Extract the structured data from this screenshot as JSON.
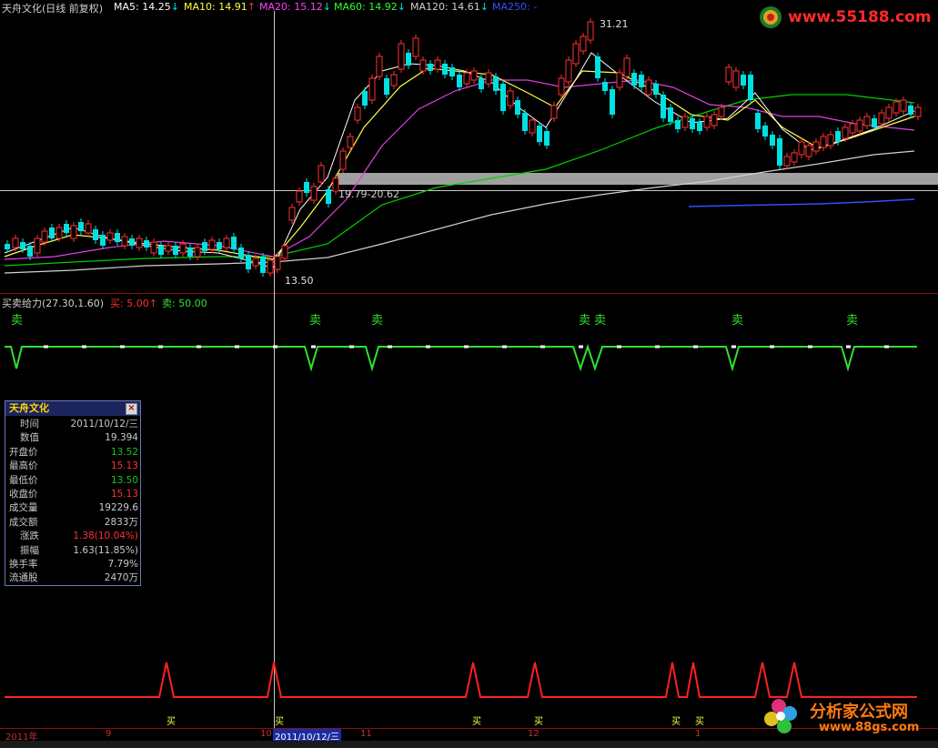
{
  "top_legend": {
    "title": "天舟文化(日线 前复权)",
    "ma5": "MA5: 14.25",
    "ma10": "MA10: 14.91",
    "ma20": "MA20: 15.12",
    "ma60": "MA60: 14.92",
    "ma120": "MA120: 14.61",
    "ma250": "MA250: -"
  },
  "price_annotations": {
    "high": "31.21",
    "low": "13.50",
    "band": "19.79-20.62"
  },
  "indicator": {
    "name": "买卖给力(27.30,1.60)",
    "buy": "买: 5.00",
    "sell": "卖: 50.00",
    "sell_mark": "卖",
    "buy_mark": "买"
  },
  "info_window": {
    "title": "天舟文化",
    "rows": [
      {
        "k": "时间",
        "v": "2011/10/12/三",
        "color": "#c8c8c8"
      },
      {
        "k": "数值",
        "v": "19.394",
        "color": "#c8c8c8"
      },
      {
        "k": "开盘价",
        "v": "13.52",
        "color": "#20c020"
      },
      {
        "k": "最高价",
        "v": "15.13",
        "color": "#ff3030"
      },
      {
        "k": "最低价",
        "v": "13.50",
        "color": "#20c020"
      },
      {
        "k": "收盘价",
        "v": "15.13",
        "color": "#ff3030"
      },
      {
        "k": "成交量",
        "v": "19229.6",
        "color": "#c8c8c8"
      },
      {
        "k": "成交额",
        "v": "2833万",
        "color": "#c8c8c8"
      },
      {
        "k": "涨跌",
        "v": "1.38(10.04%)",
        "color": "#ff3030"
      },
      {
        "k": "振幅",
        "v": "1.63(11.85%)",
        "color": "#c8c8c8"
      },
      {
        "k": "换手率",
        "v": "7.79%",
        "color": "#c8c8c8"
      },
      {
        "k": "流通股",
        "v": "2470万",
        "color": "#c8c8c8"
      }
    ]
  },
  "date_axis": {
    "year": "2011年",
    "m9": "9",
    "m10": "10",
    "cursor_date": "2011/10/12/三",
    "m11": "11",
    "m12": "12",
    "m1": "1"
  },
  "logos": {
    "top_right": "www.55188.com",
    "bottom_right_title": "分析家公式网",
    "bottom_right_url": "www.88gs.com"
  },
  "colors": {
    "up": "#ff3030",
    "down": "#00e0e0",
    "ma5": "#ffffff",
    "ma10": "#ffff00",
    "ma20": "#ff40ff",
    "ma60": "#00ff00",
    "ma120": "#c0c0c0",
    "ma250": "#3050ff"
  }
}
